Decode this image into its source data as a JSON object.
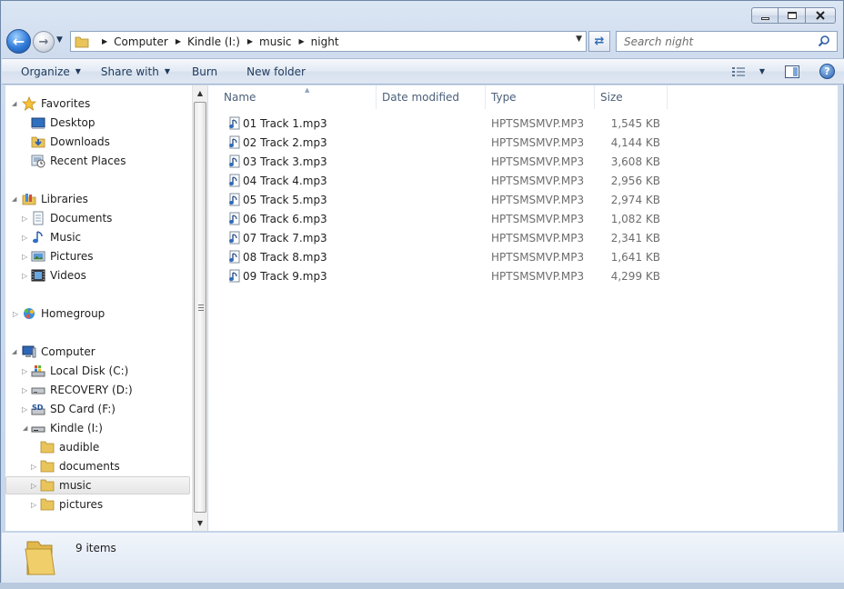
{
  "window": {
    "caption_buttons": [
      "minimize",
      "maximize",
      "close"
    ]
  },
  "navigation": {
    "breadcrumb": [
      "Computer",
      "Kindle (I:)",
      "music",
      "night"
    ],
    "search_placeholder": "Search night"
  },
  "toolbar": {
    "organize_label": "Organize",
    "share_label": "Share with",
    "burn_label": "Burn",
    "new_folder_label": "New folder"
  },
  "sidebar": {
    "favorites": {
      "label": "Favorites",
      "items": [
        {
          "label": "Desktop",
          "icon": "desktop-icon"
        },
        {
          "label": "Downloads",
          "icon": "downloads-folder-icon"
        },
        {
          "label": "Recent Places",
          "icon": "recent-places-icon"
        }
      ]
    },
    "libraries": {
      "label": "Libraries",
      "items": [
        {
          "label": "Documents",
          "icon": "documents-icon"
        },
        {
          "label": "Music",
          "icon": "music-icon"
        },
        {
          "label": "Pictures",
          "icon": "pictures-icon"
        },
        {
          "label": "Videos",
          "icon": "videos-icon"
        }
      ]
    },
    "homegroup": {
      "label": "Homegroup"
    },
    "computer": {
      "label": "Computer",
      "drives": [
        {
          "label": "Local Disk (C:)",
          "icon": "local-disk-icon"
        },
        {
          "label": "RECOVERY (D:)",
          "icon": "drive-icon"
        },
        {
          "label": "SD Card (F:)",
          "icon": "sd-card-icon"
        },
        {
          "label": "Kindle (I:)",
          "icon": "removable-drive-icon"
        }
      ],
      "kindle_folders": [
        "audible",
        "documents",
        "music",
        "pictures"
      ],
      "selected_folder": "music"
    }
  },
  "file_list": {
    "columns": {
      "name": "Name",
      "date_modified": "Date modified",
      "type": "Type",
      "size": "Size"
    },
    "sorted_by": "Name",
    "rows": [
      {
        "name": "01 Track 1.mp3",
        "date": "",
        "type": "HPTSMSMVP.MP3",
        "size": "1,545 KB"
      },
      {
        "name": "02 Track 2.mp3",
        "date": "",
        "type": "HPTSMSMVP.MP3",
        "size": "4,144 KB"
      },
      {
        "name": "03 Track 3.mp3",
        "date": "",
        "type": "HPTSMSMVP.MP3",
        "size": "3,608 KB"
      },
      {
        "name": "04 Track 4.mp3",
        "date": "",
        "type": "HPTSMSMVP.MP3",
        "size": "2,956 KB"
      },
      {
        "name": "05 Track 5.mp3",
        "date": "",
        "type": "HPTSMSMVP.MP3",
        "size": "2,974 KB"
      },
      {
        "name": "06 Track 6.mp3",
        "date": "",
        "type": "HPTSMSMVP.MP3",
        "size": "1,082 KB"
      },
      {
        "name": "07 Track 7.mp3",
        "date": "",
        "type": "HPTSMSMVP.MP3",
        "size": "2,341 KB"
      },
      {
        "name": "08 Track 8.mp3",
        "date": "",
        "type": "HPTSMSMVP.MP3",
        "size": "1,641 KB"
      },
      {
        "name": "09 Track 9.mp3",
        "date": "",
        "type": "HPTSMSMVP.MP3",
        "size": "4,299 KB"
      }
    ]
  },
  "status": {
    "item_count": "9 items"
  },
  "colors": {
    "link_blue": "#1e395b",
    "folder_yellow": "#e8c45a",
    "selection_gray": "#e6e6e6"
  }
}
